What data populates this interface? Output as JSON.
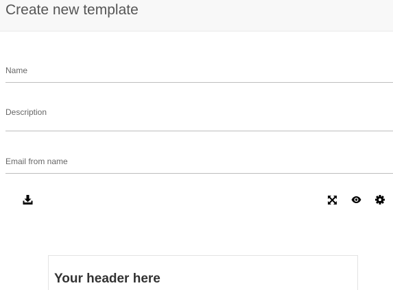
{
  "page": {
    "title": "Create new template"
  },
  "form": {
    "name": {
      "label": "Name",
      "value": ""
    },
    "description": {
      "label": "Description",
      "value": ""
    },
    "email_from_name": {
      "label": "Email from name",
      "value": ""
    }
  },
  "toolbar": {
    "left": [
      {
        "icon": "download-icon"
      }
    ],
    "right": [
      {
        "icon": "fullscreen-icon"
      },
      {
        "icon": "eye-icon"
      },
      {
        "icon": "gear-icon"
      }
    ]
  },
  "editor": {
    "header_placeholder": "Your header here"
  },
  "colors": {
    "header_bar_bg": "#f8f8f8",
    "title_text": "#555555",
    "field_label": "#666666",
    "field_underline": "#bdbdbd",
    "icon": "#000000",
    "canvas_border": "#e3e3e3"
  }
}
